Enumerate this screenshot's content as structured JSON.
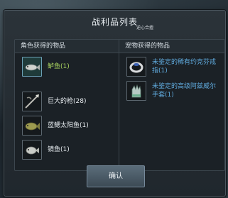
{
  "window": {
    "title": "战利品列表",
    "title_tag": "逆心合擅",
    "confirm_label": "确认"
  },
  "character_loot": {
    "header": "角色获得的物品",
    "items": [
      {
        "name": "鲈鱼(1)",
        "icon": "fish-icon",
        "color": "green"
      },
      {
        "name": "巨大的枪(28)",
        "icon": "spear-icon",
        "color": "white"
      },
      {
        "name": "蓝鳃太阳鱼(1)",
        "icon": "bluegill-icon",
        "color": "white"
      },
      {
        "name": "镜鱼(1)",
        "icon": "silver-fish-icon",
        "color": "white"
      }
    ]
  },
  "pet_loot": {
    "header": "宠物获得的物品",
    "items": [
      {
        "name": "未鉴定的稀有约克芬戒指(1)",
        "icon": "ring-icon",
        "color": "blue"
      },
      {
        "name": "未鉴定的高级阿兹威尔手套(1)",
        "icon": "gauntlet-icon",
        "color": "blue"
      }
    ]
  },
  "colors": {
    "green": "#a9d35f",
    "blue": "#5fa9dc",
    "white": "#e6ebef",
    "panel": "#2b3339"
  }
}
